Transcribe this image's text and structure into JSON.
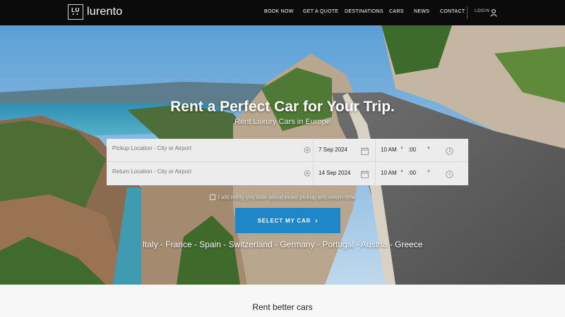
{
  "logo": {
    "mark_top": "LU",
    "mark_dots": "• •",
    "text": "lurento"
  },
  "nav": {
    "items": [
      "BOOK NOW",
      "GET A QUOTE",
      "DESTINATIONS",
      "CARS",
      "NEWS",
      "CONTACT"
    ],
    "login_label": "LOGIN",
    "user_icon": "user-icon"
  },
  "hero": {
    "title": "Rent a Perfect Car for Your Trip.",
    "subtitle": "Rent Luxury Cars in Europe",
    "pickup": {
      "placeholder": "Pickup Location - City or Airport",
      "date": "7 Sep 2024",
      "hour": "10 AM",
      "minute": ":00"
    },
    "return": {
      "placeholder": "Return Location - City or Airport",
      "date": "14 Sep 2024",
      "hour": "10 AM",
      "minute": ":00"
    },
    "notify_text": "I will notify you later about exact pickup and return time",
    "cta_label": "SELECT MY CAR",
    "countries": "Italy - France - Spain - Switzerland - Germany - Portugal - Austria - Greece"
  },
  "section": {
    "title": "Rent better cars"
  },
  "colors": {
    "nav_bg": "#0b0b0b",
    "cta": "#1f86c8",
    "form_bg": "#ececec"
  }
}
